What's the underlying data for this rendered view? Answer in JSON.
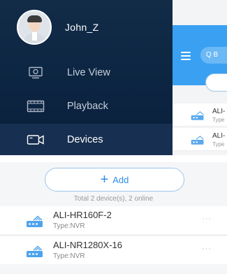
{
  "drawer": {
    "username": "John_Z",
    "menu": [
      {
        "label": "Live View",
        "icon": "monitor-icon"
      },
      {
        "label": "Playback",
        "icon": "film-icon"
      },
      {
        "label": "Devices",
        "icon": "camera-icon",
        "active": true
      }
    ]
  },
  "app_behind": {
    "search_label": "Q B",
    "rows": [
      {
        "name": "ALI-",
        "type": "Type"
      },
      {
        "name": "ALI-",
        "type": "Type"
      }
    ]
  },
  "devices": {
    "add_label": "Add",
    "total_text": "Total 2 device(s), 2 online",
    "list": [
      {
        "name": "ALI-HR160F-2",
        "type": "Type:NVR",
        "more": "···"
      },
      {
        "name": "ALI-NR1280X-16",
        "type": "Type:NVR",
        "more": "···"
      }
    ]
  },
  "colors": {
    "drawer_bg": "#0c2542",
    "accent_blue": "#2f8ee8",
    "header_blue": "#3aa0f2"
  }
}
